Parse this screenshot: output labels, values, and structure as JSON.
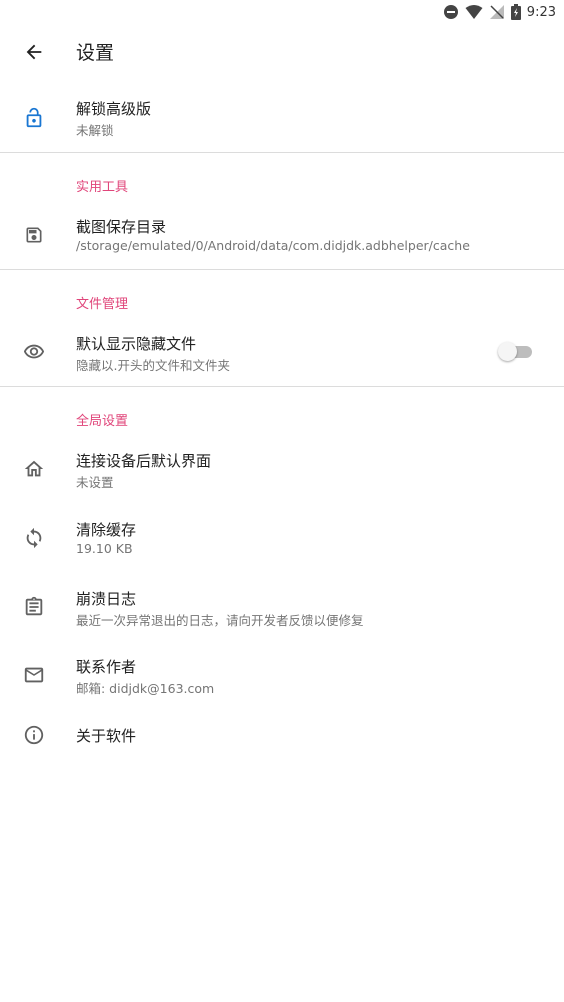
{
  "status_bar": {
    "time": "9:23"
  },
  "app_bar": {
    "title": "设置"
  },
  "unlock": {
    "title": "解锁高级版",
    "summary": "未解锁"
  },
  "categories": {
    "tools": "实用工具",
    "files": "文件管理",
    "global": "全局设置"
  },
  "screenshot_dir": {
    "title": "截图保存目录",
    "summary": "/storage/emulated/0/Android/data/com.didjdk.adbhelper/cache"
  },
  "hidden_files": {
    "title": "默认显示隐藏文件",
    "summary": "隐藏以.开头的文件和文件夹",
    "enabled": false
  },
  "default_screen": {
    "title": "连接设备后默认界面",
    "summary": "未设置"
  },
  "clear_cache": {
    "title": "清除缓存",
    "summary": "19.10 KB"
  },
  "crash_log": {
    "title": "崩溃日志",
    "summary": "最近一次异常退出的日志，请向开发者反馈以便修复"
  },
  "contact": {
    "title": "联系作者",
    "summary": "邮箱: didjdk@163.com"
  },
  "about": {
    "title": "关于软件"
  },
  "colors": {
    "accent": "#e0457a",
    "unlock_icon": "#1976d2",
    "icon": "#616161"
  }
}
